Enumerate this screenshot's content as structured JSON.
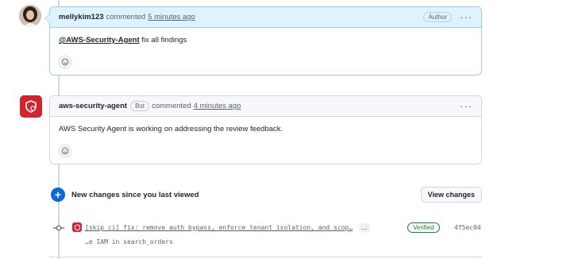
{
  "comments": [
    {
      "user": "mellykim123",
      "action": "commented",
      "time": "5 minutes ago",
      "badge": "Author",
      "mention": "@AWS-Security-Agent",
      "text": " fix all findings",
      "icons": {
        "avatar": "user-avatar",
        "menu": "kebab-menu-icon",
        "reaction": "smiley-icon"
      }
    },
    {
      "user": "aws-security-agent",
      "bot_badge": "Bot",
      "action": "commented",
      "time": "4 minutes ago",
      "text": "AWS Security Agent is working on addressing the review feedback.",
      "icons": {
        "avatar": "aws-security-agent-logo",
        "menu": "kebab-menu-icon",
        "reaction": "smiley-icon"
      }
    }
  ],
  "new_changes": {
    "label": "New changes since you last viewed",
    "button": "View changes",
    "icon": "plus-circle-icon"
  },
  "commit": {
    "message": "[skip ci] fix: remove auth bypass, enforce tenant isolation, and scop…",
    "expand": "…",
    "verified": "Verified",
    "sha": "4f5ec04",
    "continuation": "…e IAM in search_orders",
    "icon": "git-commit-icon"
  },
  "colors": {
    "accent": "#0969da",
    "bot": "#d1242f",
    "verified": "#1a7f37",
    "author_header": "#ddf4ff"
  }
}
